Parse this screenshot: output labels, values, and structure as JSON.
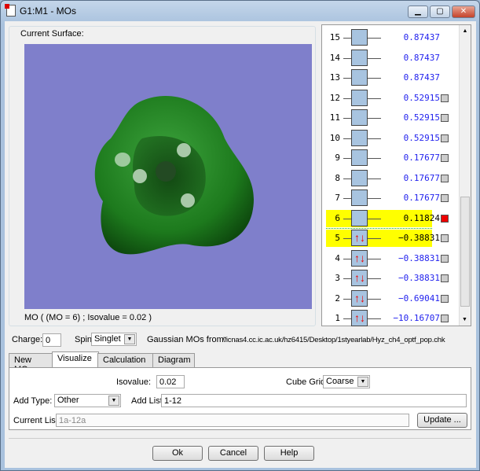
{
  "window": {
    "title": "G1:M1 - MOs",
    "minimize": "▁",
    "maximize": "▢",
    "close": "✕"
  },
  "surface": {
    "group_label": "Current Surface:",
    "info": "MO ( (MO = 6) ; Isovalue = 0.02 )",
    "background_color": "#7f7fcb",
    "orbital_color": "#1e7a1e"
  },
  "mo_list": [
    {
      "n": "15",
      "energy": "0.87437",
      "occ": 0,
      "checkbox": false
    },
    {
      "n": "14",
      "energy": "0.87437",
      "occ": 0,
      "checkbox": false
    },
    {
      "n": "13",
      "energy": "0.87437",
      "occ": 0,
      "checkbox": false
    },
    {
      "n": "12",
      "energy": "0.52915",
      "occ": 0,
      "checkbox": true
    },
    {
      "n": "11",
      "energy": "0.52915",
      "occ": 0,
      "checkbox": true
    },
    {
      "n": "10",
      "energy": "0.52915",
      "occ": 0,
      "checkbox": true
    },
    {
      "n": "9",
      "energy": "0.17677",
      "occ": 0,
      "checkbox": true
    },
    {
      "n": "8",
      "energy": "0.17677",
      "occ": 0,
      "checkbox": true
    },
    {
      "n": "7",
      "energy": "0.17677",
      "occ": 0,
      "checkbox": true
    },
    {
      "n": "6",
      "energy": "0.11824",
      "occ": 0,
      "checkbox": true,
      "highlight": true,
      "active": true
    },
    {
      "n": "5",
      "energy": "−0.38831",
      "occ": 2,
      "checkbox": true,
      "highlight": true
    },
    {
      "n": "4",
      "energy": "−0.38831",
      "occ": 2,
      "checkbox": true
    },
    {
      "n": "3",
      "energy": "−0.38831",
      "occ": 2,
      "checkbox": true
    },
    {
      "n": "2",
      "energy": "−0.69041",
      "occ": 2,
      "checkbox": true
    },
    {
      "n": "1",
      "energy": "−10.16707",
      "occ": 2,
      "checkbox": true
    }
  ],
  "charge": {
    "label": "Charge:",
    "value": "0"
  },
  "spin": {
    "label": "Spin:",
    "value": "Singlet"
  },
  "source": {
    "label": "Gaussian MOs from:",
    "path": "//icnas4.cc.ic.ac.uk/hz6415/Desktop/1styearlab/Hyz_ch4_optf_pop.chk"
  },
  "tabs": [
    {
      "label": "New MOs"
    },
    {
      "label": "Visualize",
      "active": true
    },
    {
      "label": "Calculation"
    },
    {
      "label": "Diagram"
    }
  ],
  "visualize": {
    "isovalue_label": "Isovalue:",
    "isovalue": "0.02",
    "cube_grid_label": "Cube Grid:",
    "cube_grid": "Coarse",
    "add_type_label": "Add Type:",
    "add_type": "Other",
    "add_list_label": "Add List:",
    "add_list": "1-12",
    "current_list_label": "Current List:",
    "current_list": "1a-12a",
    "update": "Update ..."
  },
  "buttons": {
    "ok": "Ok",
    "cancel": "Cancel",
    "help": "Help"
  }
}
